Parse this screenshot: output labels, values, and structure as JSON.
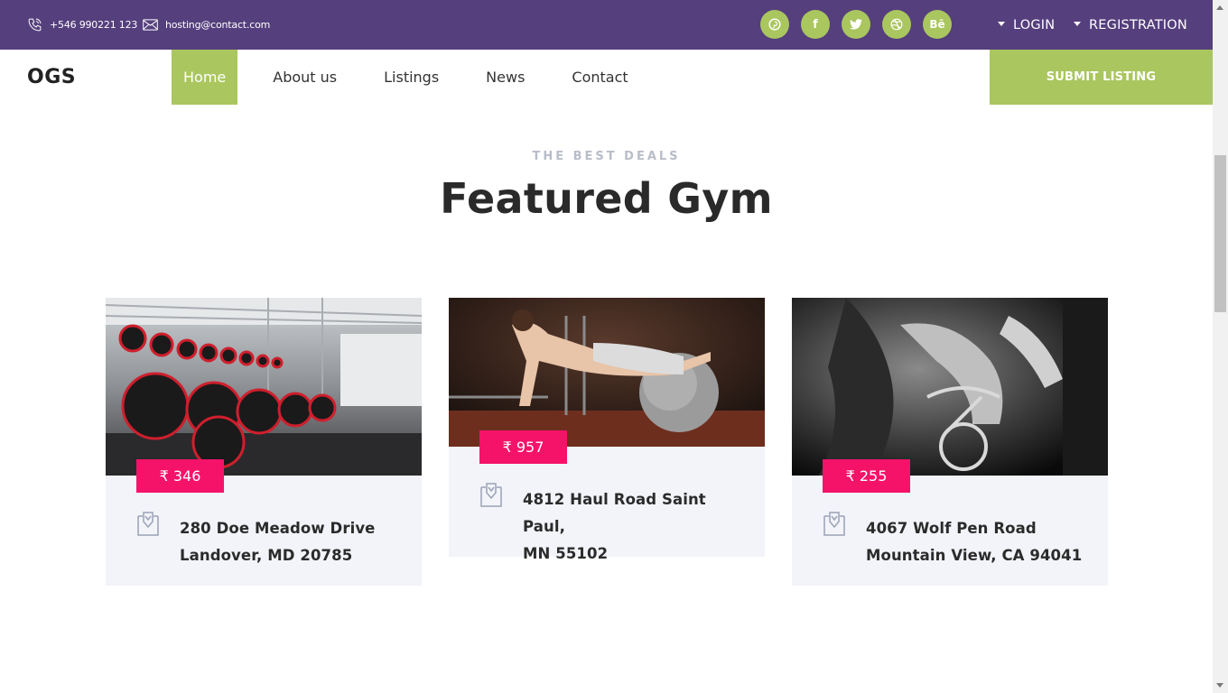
{
  "topbar": {
    "phone": "+546 990221 123",
    "email": "hosting@contact.com",
    "socials": [
      {
        "icon": "pinterest-icon",
        "glyph": "℗"
      },
      {
        "icon": "facebook-icon",
        "glyph": "f"
      },
      {
        "icon": "twitter-icon",
        "glyph": "🐦"
      },
      {
        "icon": "dribbble-icon",
        "glyph": "◍"
      },
      {
        "icon": "behance-icon",
        "glyph": "Bē"
      }
    ],
    "login": "LOGIN",
    "registration": "REGISTRATION"
  },
  "nav": {
    "logo": "OGS",
    "items": [
      "Home",
      "About us",
      "Listings",
      "News",
      "Contact"
    ],
    "active": "Home",
    "submit": "SUBMIT LISTING"
  },
  "section": {
    "eyebrow": "THE BEST DEALS",
    "title": "Featured Gym"
  },
  "cards": [
    {
      "price": "₹ 346",
      "address_line1": "280 Doe Meadow Drive",
      "address_line2": "Landover, MD 20785",
      "image": "dumbbell-rack-photo"
    },
    {
      "price": "₹ 957",
      "address_line1": "4812 Haul Road Saint Paul,",
      "address_line2": "MN 55102",
      "image": "plank-exercise-photo"
    },
    {
      "price": "₹ 255",
      "address_line1": "4067 Wolf Pen Road",
      "address_line2": "Mountain View, CA 94041",
      "image": "spin-class-photo"
    }
  ],
  "colors": {
    "topbar": "#553f7d",
    "accent_green": "#aac65f",
    "price_pink": "#f5136a",
    "card_bg": "#f2f4f9"
  }
}
